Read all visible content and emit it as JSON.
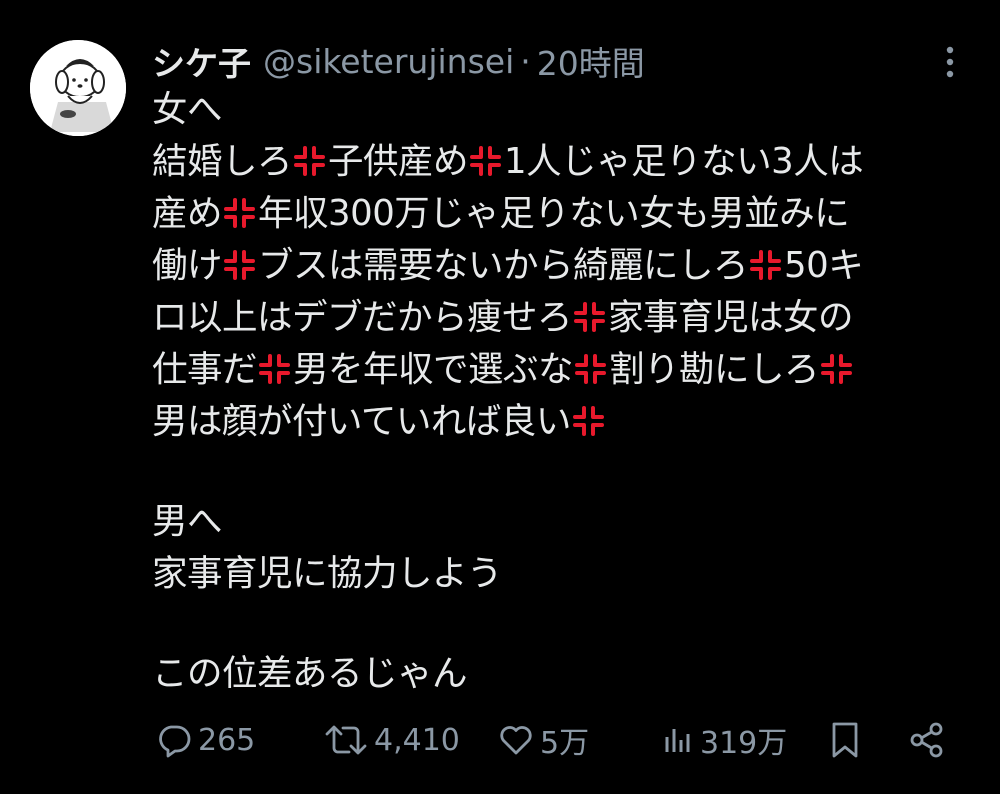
{
  "tweet": {
    "display_name": "シケ子",
    "handle": "@siketerujinsei",
    "separator": "·",
    "timestamp": "20時間",
    "line_1": "女へ",
    "line_2": [
      "結婚しろ",
      "子供産め",
      "1人じゃ足りない3人は"
    ],
    "line_3": [
      "産め",
      "年収300万じゃ足りない女も男並みに"
    ],
    "line_4": [
      "働け",
      "ブスは需要ないから綺麗にしろ",
      "50キ"
    ],
    "line_5": [
      "ロ以上はデブだから痩せろ",
      "家事育児は女の"
    ],
    "line_6": [
      "仕事だ",
      "男を年収で選ぶな",
      "割り勘にしろ"
    ],
    "line_7": [
      "男は顔が付いていれば良い"
    ],
    "line_8": "男へ",
    "line_9": "家事育児に協力しよう",
    "line_10": "この位差あるじゃん",
    "emoji": "anger-symbol-icon"
  },
  "stats": {
    "replies": "265",
    "retweets": "4,410",
    "likes": "5万",
    "views": "319万"
  },
  "icons": {
    "reply": "reply-icon",
    "retweet": "retweet-icon",
    "like": "heart-icon",
    "views": "views-icon",
    "bookmark": "bookmark-icon",
    "share": "share-icon",
    "more": "more-icon"
  },
  "colors": {
    "background": "#000000",
    "text": "#e7e9ea",
    "secondary": "#8b98a5",
    "anger": "#e8192c"
  }
}
